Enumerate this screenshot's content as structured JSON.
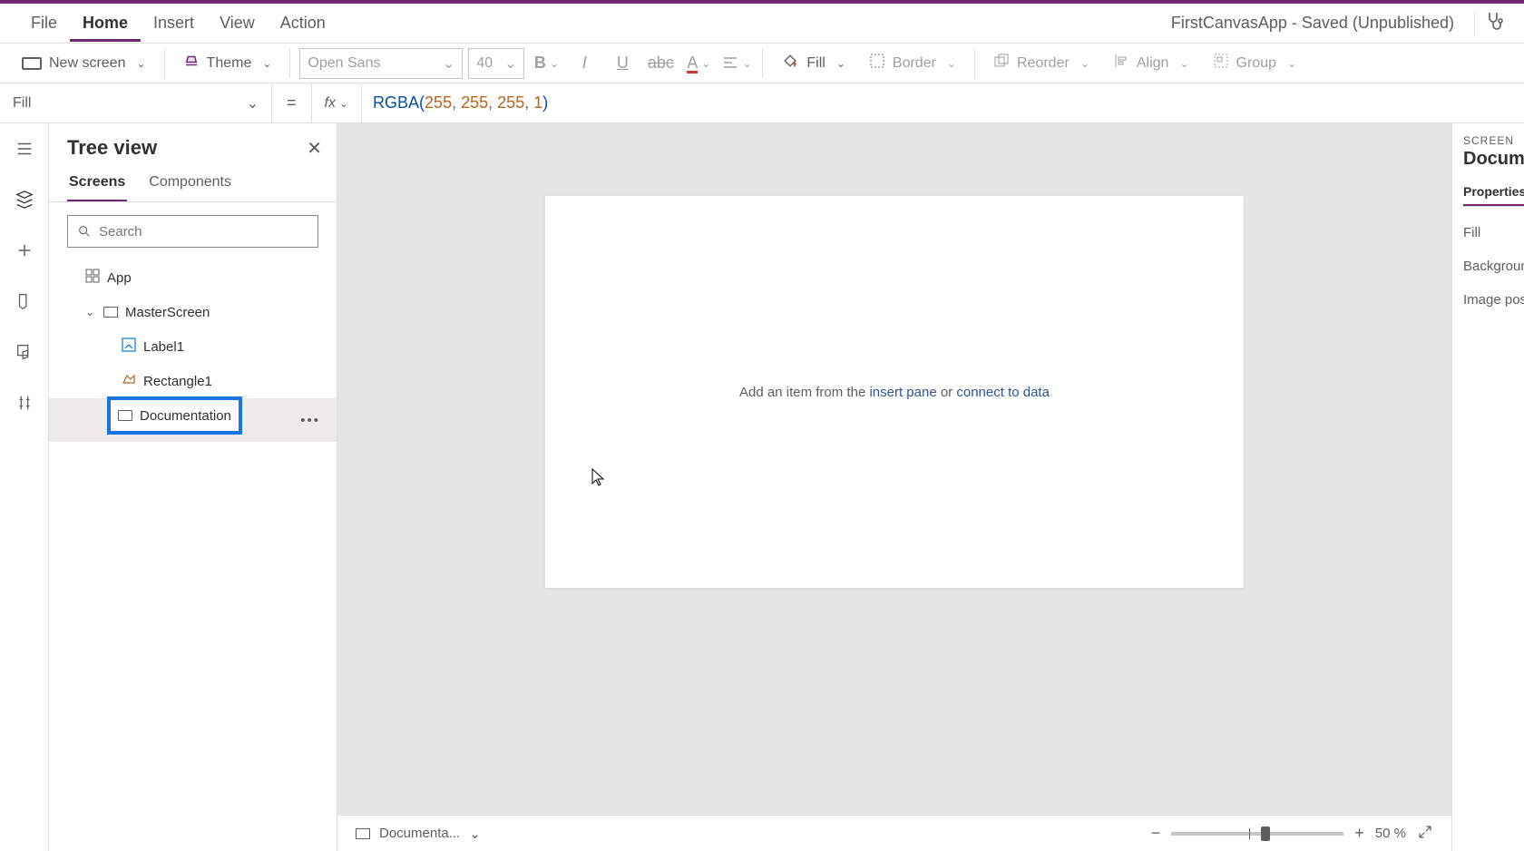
{
  "menubar": {
    "items": [
      "File",
      "Home",
      "Insert",
      "View",
      "Action"
    ],
    "activeIndex": 1,
    "appTitle": "FirstCanvasApp - Saved (Unpublished)"
  },
  "ribbon": {
    "newScreen": "New screen",
    "theme": "Theme",
    "font": "Open Sans",
    "fontSize": "40",
    "fill": "Fill",
    "border": "Border",
    "reorder": "Reorder",
    "align": "Align",
    "group": "Group"
  },
  "formulaBar": {
    "property": "Fill",
    "eq": "=",
    "fx": "fx",
    "fn": "RGBA",
    "args": [
      "255",
      "255",
      "255",
      "1"
    ]
  },
  "tree": {
    "title": "Tree view",
    "tabs": [
      "Screens",
      "Components"
    ],
    "activeTab": 0,
    "searchPlaceholder": "Search",
    "items": [
      {
        "label": "App",
        "type": "app"
      },
      {
        "label": "MasterScreen",
        "type": "screen",
        "expanded": true
      },
      {
        "label": "Label1",
        "type": "label"
      },
      {
        "label": "Rectangle1",
        "type": "shape"
      },
      {
        "label": "Documentation",
        "type": "screen",
        "selected": true
      }
    ]
  },
  "canvas": {
    "placeholderPrefix": "Add an item from the ",
    "link1": "insert pane",
    "middle": " or ",
    "link2": "connect to data"
  },
  "footer": {
    "selected": "Documenta...",
    "zoomValue": "50",
    "zoomUnit": "%"
  },
  "props": {
    "sectionLabel": "SCREEN",
    "screenName": "Document",
    "tabActive": "Properties",
    "rows": [
      "Fill",
      "Background",
      "Image posit"
    ]
  }
}
